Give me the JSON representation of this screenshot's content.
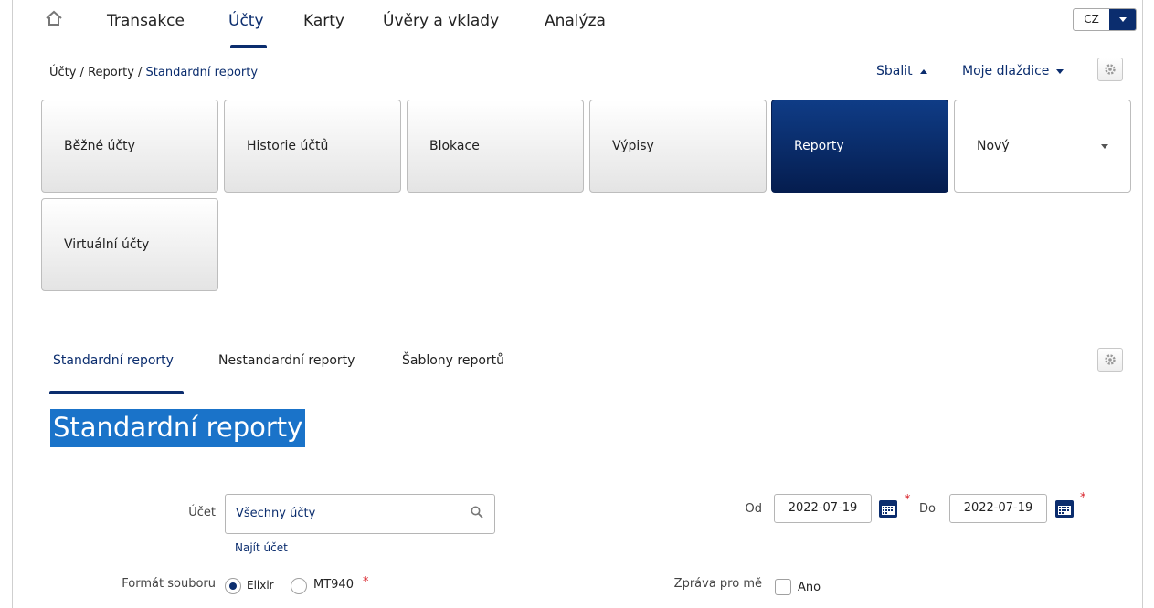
{
  "nav": {
    "items": [
      {
        "label": "Transakce"
      },
      {
        "label": "Účty"
      },
      {
        "label": "Karty"
      },
      {
        "label": "Úvěry a vklady"
      },
      {
        "label": "Analýza"
      }
    ],
    "language": "CZ"
  },
  "breadcrumb": {
    "part1": "Účty / Reporty / ",
    "current": "Standardní reporty"
  },
  "toolbar": {
    "collapse_label": "Sbalit",
    "tiles_label": "Moje dlaždice"
  },
  "tiles": [
    {
      "label": "Běžné účty"
    },
    {
      "label": "Historie účtů"
    },
    {
      "label": "Blokace"
    },
    {
      "label": "Výpisy"
    },
    {
      "label": "Reporty"
    },
    {
      "label": "Nový"
    },
    {
      "label": "Virtuální účty"
    }
  ],
  "subtabs": [
    {
      "label": "Standardní reporty"
    },
    {
      "label": "Nestandardní reporty"
    },
    {
      "label": "Šablony reportů"
    }
  ],
  "page_title": "Standardní reporty",
  "form": {
    "account_label": "Účet",
    "account_value": "Všechny účty",
    "find_account": "Najít účet",
    "from_label": "Od",
    "from_value": "2022-07-19",
    "to_label": "Do",
    "to_value": "2022-07-19",
    "required_mark": "*",
    "format_label": "Formát souboru",
    "format_options": [
      "Elixir",
      "MT940"
    ],
    "format_selected": "Elixir",
    "message_label": "Zpráva pro mě",
    "message_option": "Ano",
    "message_checked": false
  },
  "colors": {
    "accent": "#0b2d6e",
    "selection": "#1a73c9",
    "required": "#d9262e"
  }
}
